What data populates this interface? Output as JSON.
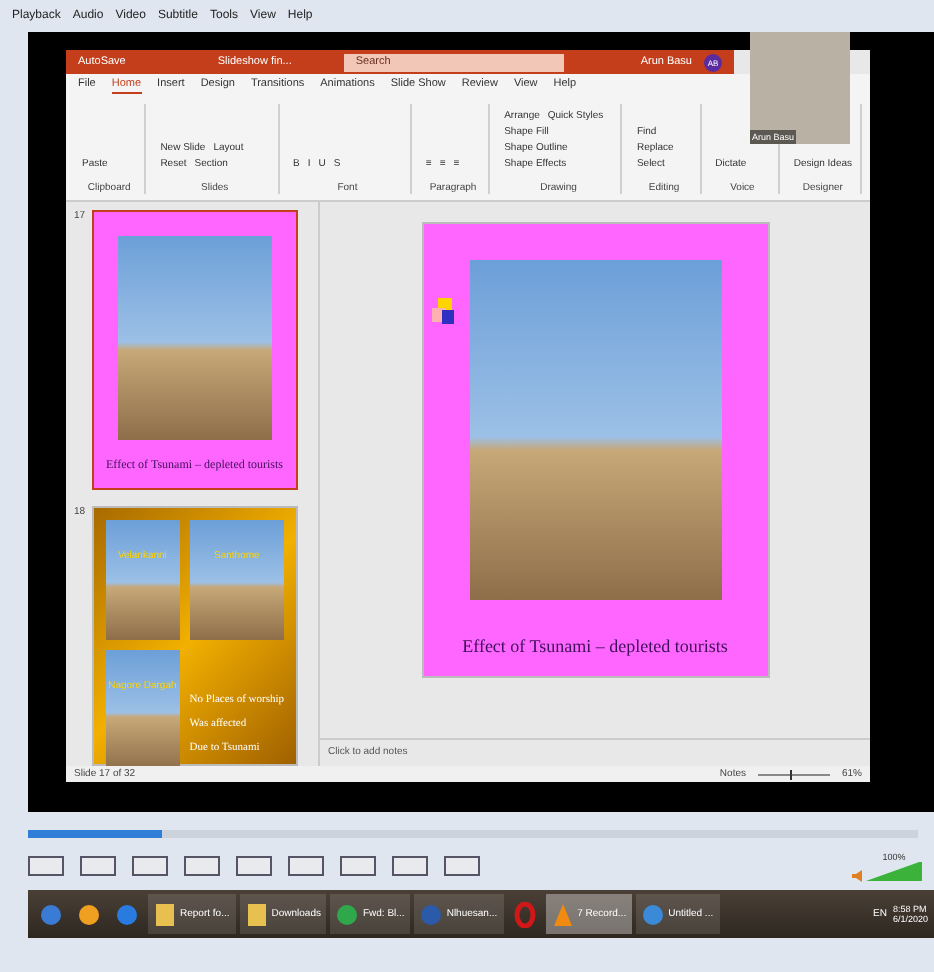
{
  "player_menu": [
    "Playback",
    "Audio",
    "Video",
    "Subtitle",
    "Tools",
    "View",
    "Help"
  ],
  "powerpoint": {
    "title_bar": {
      "autosave": "AutoSave",
      "document": "Slideshow fin...",
      "search_placeholder": "Search",
      "user": "Arun Basu",
      "initials": "AB"
    },
    "ribbon_tabs": [
      {
        "label": "File",
        "selected": false
      },
      {
        "label": "Home",
        "selected": true
      },
      {
        "label": "Insert",
        "selected": false
      },
      {
        "label": "Design",
        "selected": false
      },
      {
        "label": "Transitions",
        "selected": false
      },
      {
        "label": "Animations",
        "selected": false
      },
      {
        "label": "Slide Show",
        "selected": false
      },
      {
        "label": "Review",
        "selected": false
      },
      {
        "label": "View",
        "selected": false
      },
      {
        "label": "Help",
        "selected": false
      }
    ],
    "ribbon_groups": [
      {
        "label": "Clipboard",
        "buttons": [
          "Paste"
        ]
      },
      {
        "label": "Slides",
        "buttons": [
          "New Slide",
          "Layout",
          "Reset",
          "Section"
        ]
      },
      {
        "label": "Font",
        "buttons": [
          "B",
          "I",
          "U",
          "S"
        ]
      },
      {
        "label": "Paragraph",
        "buttons": [
          "≡",
          "≡",
          "≡"
        ]
      },
      {
        "label": "Drawing",
        "buttons": [
          "Arrange",
          "Quick Styles",
          "Shape Fill",
          "Shape Outline",
          "Shape Effects"
        ]
      },
      {
        "label": "Editing",
        "buttons": [
          "Find",
          "Replace",
          "Select"
        ]
      },
      {
        "label": "Voice",
        "buttons": [
          "Dictate"
        ]
      },
      {
        "label": "Designer",
        "buttons": [
          "Design Ideas"
        ]
      }
    ],
    "thumbnails": [
      {
        "number": "17",
        "kind": "photo",
        "selected": true,
        "caption": "Effect of Tsunami – depleted tourists"
      },
      {
        "number": "18",
        "kind": "collage",
        "selected": false,
        "photo_labels": [
          "Velankanni",
          "Santhome",
          "Nagore Dargah"
        ],
        "lines": [
          "No Places of worship",
          "Was affected",
          "Due to Tsunami"
        ]
      }
    ],
    "slide": {
      "caption": "Effect of Tsunami – depleted tourists"
    },
    "notes_placeholder": "Click to add notes",
    "status_bar": {
      "slide": "Slide 17 of 32",
      "notes": "Notes",
      "zoom": "61%",
      "zoom_slider": {
        "level": 0.45
      }
    }
  },
  "webcam": {
    "name": "Arun Basu"
  },
  "seek": {
    "level": 0.15
  },
  "volume": {
    "reading": "100%",
    "level": 1
  },
  "taskbar": [
    {
      "kind": "media"
    },
    {
      "kind": "browser"
    },
    {
      "kind": "ie"
    },
    {
      "kind": "folder",
      "label": "Report fo..."
    },
    {
      "kind": "folder",
      "label": "Downloads"
    },
    {
      "kind": "chrome",
      "label": "Fwd: Bl..."
    },
    {
      "kind": "word",
      "label": "Nlhuesan..."
    },
    {
      "kind": "opera"
    },
    {
      "kind": "vlc",
      "label": "7 Record...",
      "selected": true
    },
    {
      "kind": "paint",
      "label": "Untitled ..."
    }
  ],
  "tray": {
    "language": "EN",
    "time": "8:58 PM",
    "date": "6/1/2020"
  }
}
